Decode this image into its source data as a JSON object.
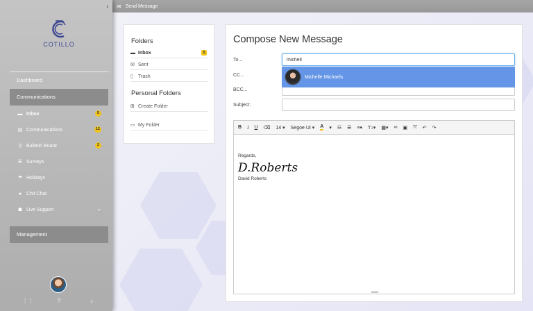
{
  "topbar": {
    "title": "Send Message",
    "icon": "envelope-icon"
  },
  "logo": {
    "text": "COTILLO"
  },
  "sidebar": {
    "sections": [
      {
        "label": "Dashboard"
      },
      {
        "label": "Communications"
      },
      {
        "label": "Management"
      }
    ],
    "items": [
      {
        "label": "Inbox",
        "icon": "inbox-icon",
        "badge": "5"
      },
      {
        "label": "Communications",
        "icon": "id-card-icon",
        "badge": "12"
      },
      {
        "label": "Bulletin Board",
        "icon": "pin-icon",
        "badge": "2"
      },
      {
        "label": "Surveys",
        "icon": "survey-icon"
      },
      {
        "label": "Holidays",
        "icon": "holidays-icon"
      },
      {
        "label": "Chit Chat",
        "icon": "chat-icon"
      },
      {
        "label": "Live Support",
        "icon": "sitemap-icon"
      }
    ],
    "footer_icons": [
      "apps-icon",
      "help-icon",
      "bell-icon"
    ]
  },
  "folders": {
    "title": "Folders",
    "items": [
      {
        "label": "Inbox",
        "badge": "5",
        "icon": "inbox-icon"
      },
      {
        "label": "Sent",
        "icon": "envelope-icon"
      },
      {
        "label": "Trash",
        "icon": "trash-icon"
      }
    ],
    "personal_title": "Personal Folders",
    "personal_items": [
      {
        "label": "Create Folder",
        "icon": "plus-square-icon"
      },
      {
        "label": "My Folder",
        "icon": "folder-icon"
      }
    ]
  },
  "compose": {
    "title": "Compose New Message",
    "to_label": "To...",
    "to_value": "michell",
    "suggestion": "Michelle Michaels",
    "cc_label": "CC...",
    "bcc_label": "BCC...",
    "subject_label": "Subject:",
    "subject_value": "",
    "toolbar": {
      "font_size": "14",
      "font_name": "Segoe UI"
    },
    "body": {
      "regards": "Regards,",
      "signature_script": "D.Roberts",
      "signature_name": "David Roberts"
    }
  }
}
